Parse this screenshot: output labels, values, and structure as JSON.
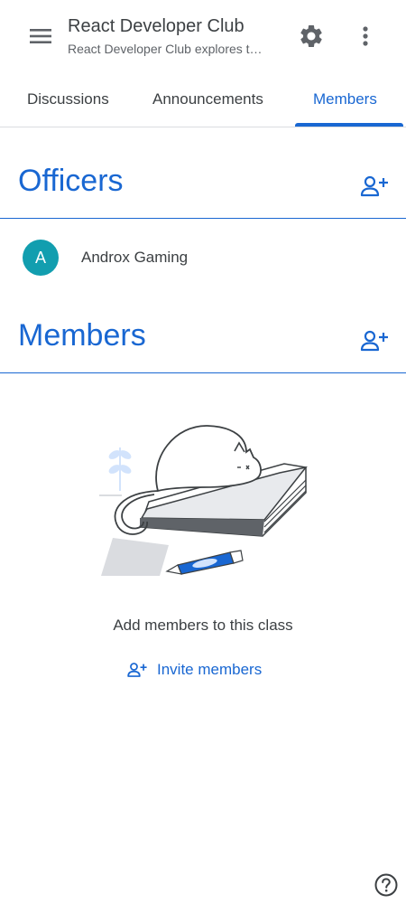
{
  "header": {
    "title": "React Developer Club",
    "subtitle": "React Developer Club explores t…"
  },
  "tabs": [
    {
      "label": "Discussions",
      "active": false
    },
    {
      "label": "Announcements",
      "active": false
    },
    {
      "label": "Members",
      "active": true
    }
  ],
  "officers": {
    "title": "Officers",
    "items": [
      {
        "initial": "A",
        "name": "Androx Gaming",
        "avatar_color": "#129eaf"
      }
    ]
  },
  "members": {
    "title": "Members",
    "empty_text": "Add members to this class",
    "invite_label": "Invite members"
  },
  "colors": {
    "accent": "#1967d2",
    "text": "#3c4043",
    "divider": "#dadce0"
  },
  "icons": {
    "menu": "menu-icon",
    "settings": "gear-icon",
    "more": "more-vert-icon",
    "add_person": "person-add-icon",
    "help": "help-circle-icon"
  }
}
